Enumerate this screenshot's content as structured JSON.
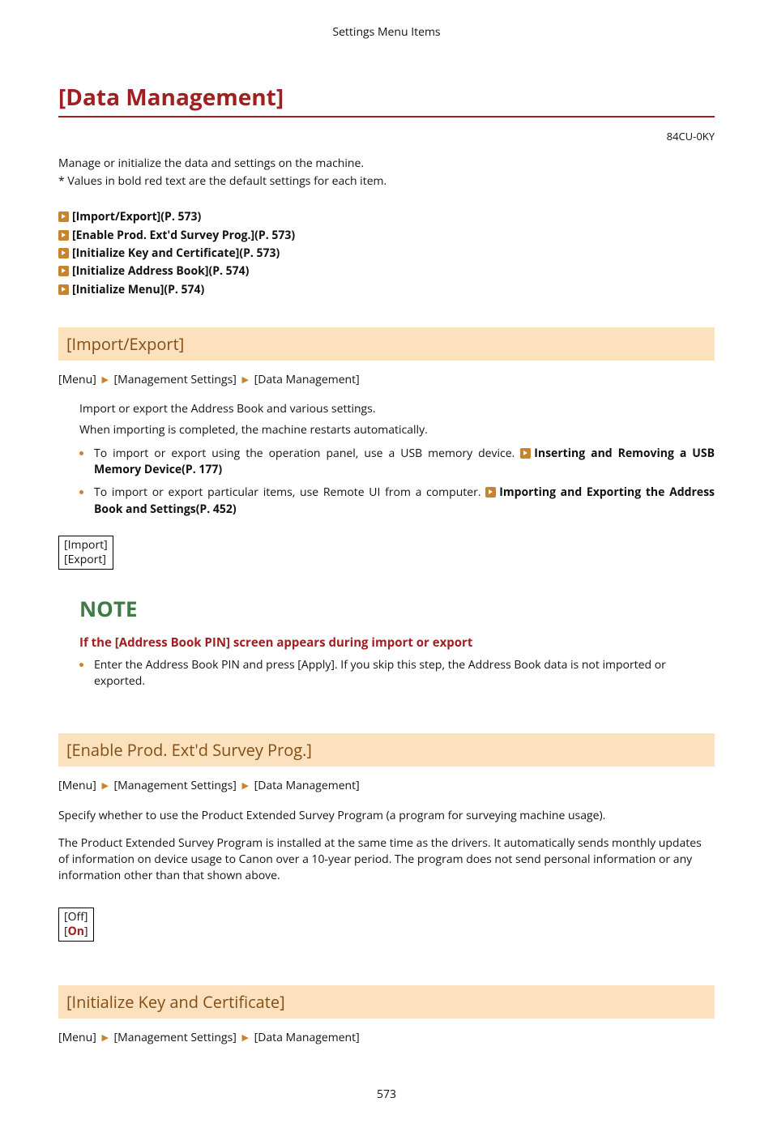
{
  "header_crumb": "Settings Menu Items",
  "title": "[Data Management]",
  "doc_id": "84CU-0KY",
  "intro": {
    "l1": "Manage or initialize the data and settings on the machine.",
    "l2": "* Values in bold red text are the default settings for each item."
  },
  "toc": {
    "items": [
      "[Import/Export](P. 573)",
      "[Enable Prod. Ext'd Survey Prog.](P. 573)",
      "[Initialize Key and Certificate](P. 573)",
      "[Initialize Address Book](P. 574)",
      "[Initialize Menu](P. 574)"
    ]
  },
  "sec1": {
    "heading": "[Import/Export]",
    "bc": {
      "a": "[Menu]",
      "b": "[Management Settings]",
      "c": "[Data Management]"
    },
    "p1": "Import or export the Address Book and various settings.",
    "p2": "When importing is completed, the machine restarts automatically.",
    "b1_pre": "To import or export using the operation panel, use a USB memory device. ",
    "b1_link": "Inserting and Removing a USB Memory Device(P. 177)",
    "b2_pre": "To import or export particular items, use Remote UI from a computer. ",
    "b2_link": "Importing and Exporting the Address Book and Settings(P. 452)",
    "opts": {
      "a": "[Import]",
      "b": "[Export]"
    }
  },
  "note": {
    "heading": "NOTE",
    "sub": "If the [Address Book PIN] screen appears during import or export",
    "li": "Enter the Address Book PIN and press [Apply]. If you skip this step, the Address Book data is not imported or exported."
  },
  "sec2": {
    "heading": "[Enable Prod. Ext'd Survey Prog.]",
    "bc": {
      "a": "[Menu]",
      "b": "[Management Settings]",
      "c": "[Data Management]"
    },
    "p1": "Specify whether to use the Product Extended Survey Program (a program for surveying machine usage).",
    "p2": "The Product Extended Survey Program is installed at the same time as the drivers. It automatically sends monthly updates of information on device usage to Canon over a 10-year period. The program does not send personal information or any information other than that shown above.",
    "opts": {
      "off": "[Off]",
      "on_open": "[",
      "on_text": "On",
      "on_close": "]"
    }
  },
  "sec3": {
    "heading": "[Initialize Key and Certificate]",
    "bc": {
      "a": "[Menu]",
      "b": "[Management Settings]",
      "c": "[Data Management]"
    }
  },
  "page_number": "573"
}
